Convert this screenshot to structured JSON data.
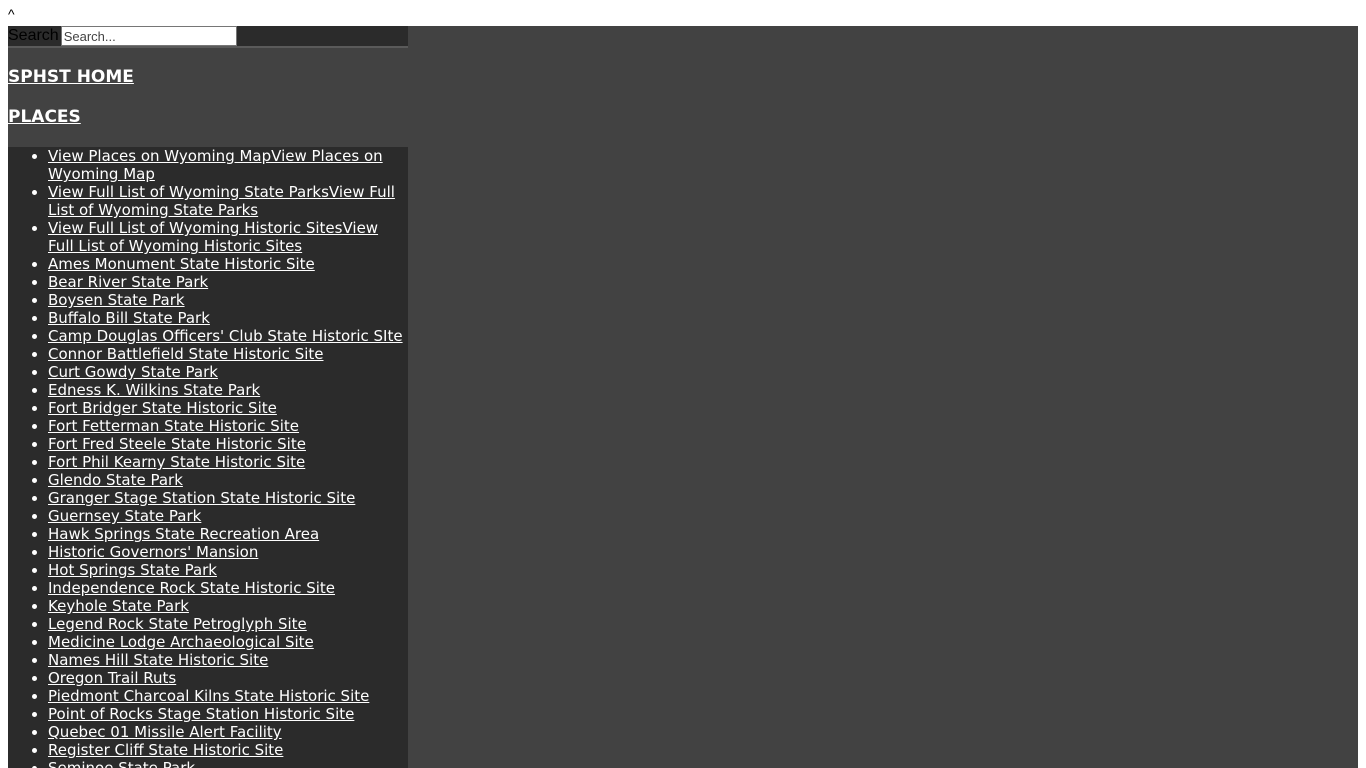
{
  "top_caret": "^",
  "search": {
    "label": "Search",
    "placeholder": "Search..."
  },
  "nav": {
    "home_label": "SPHST HOME",
    "places_label": "PLACES"
  },
  "places": [
    "View Places on Wyoming MapView Places on Wyoming Map",
    "View Full List of Wyoming State ParksView Full List of Wyoming State Parks",
    "View Full List of Wyoming Historic SitesView Full List of Wyoming Historic Sites",
    "Ames Monument State Historic Site",
    "Bear River State Park",
    "Boysen State Park",
    "Buffalo Bill State Park",
    "Camp Douglas Officers' Club State Historic SIte",
    "Connor Battlefield State Historic Site",
    "Curt Gowdy State Park",
    "Edness K. Wilkins State Park",
    "Fort Bridger State Historic Site",
    "Fort Fetterman State Historic Site",
    "Fort Fred Steele State Historic Site",
    "Fort Phil Kearny State Historic Site",
    "Glendo State Park",
    "Granger Stage Station State Historic Site",
    "Guernsey State Park",
    "Hawk Springs State Recreation Area",
    "Historic Governors' Mansion",
    "Hot Springs State Park",
    "Independence Rock State Historic Site",
    "Keyhole State Park",
    "Legend Rock State Petroglyph Site",
    "Medicine Lodge Archaeological Site",
    "Names Hill State Historic Site",
    "Oregon Trail Ruts",
    "Piedmont Charcoal Kilns State Historic Site",
    "Point of Rocks Stage Station Historic Site",
    "Quebec 01 Missile Alert Facility",
    "Register Cliff State Historic Site",
    "Seminoe State Park"
  ],
  "colors": {
    "sidebar_bg": "#2b2b2b",
    "panel_bg": "#424242",
    "link": "#ffffff"
  }
}
